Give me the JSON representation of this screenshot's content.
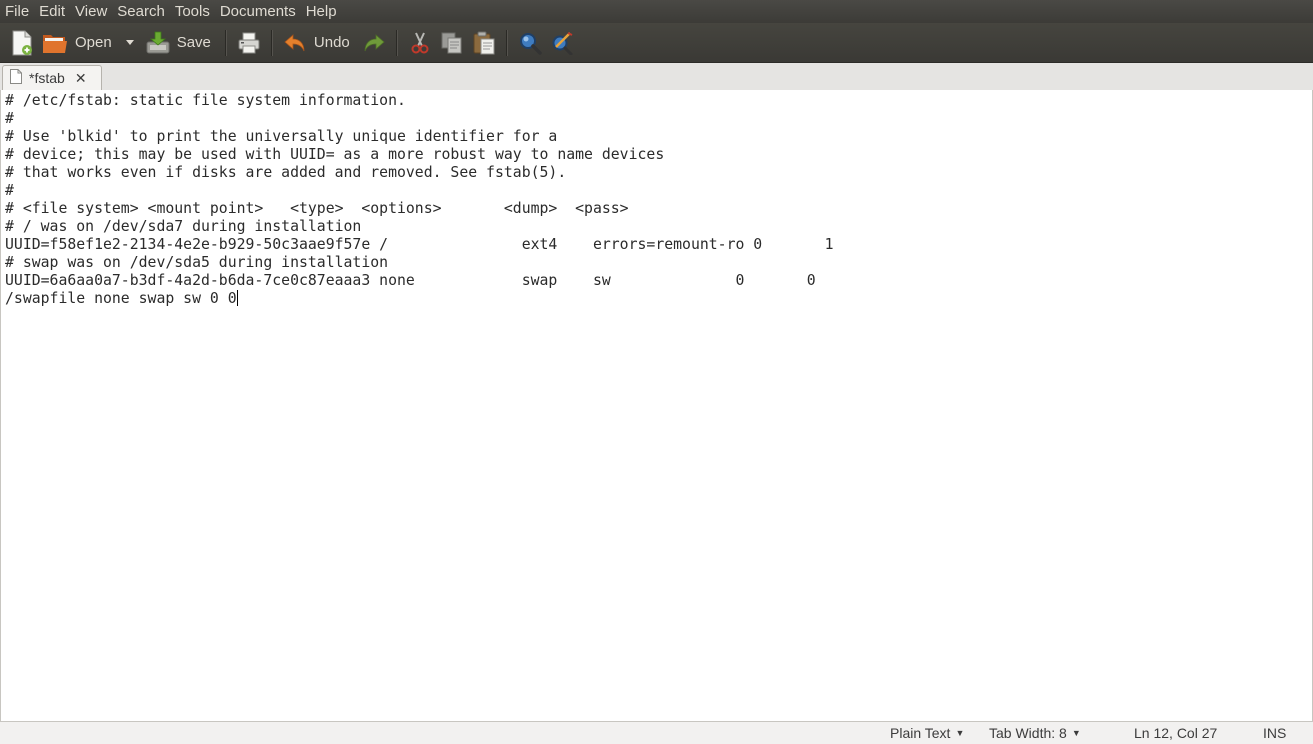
{
  "menubar": {
    "items": [
      "File",
      "Edit",
      "View",
      "Search",
      "Tools",
      "Documents",
      "Help"
    ]
  },
  "toolbar": {
    "new_icon": "new-document-icon",
    "open_label": "Open",
    "save_label": "Save",
    "print_icon": "print-icon",
    "undo_label": "Undo",
    "redo_icon": "redo-icon",
    "cut_icon": "cut-icon",
    "copy_icon": "copy-icon",
    "paste_icon": "paste-icon",
    "find_icon": "search-icon",
    "replace_icon": "find-replace-icon"
  },
  "tabs": [
    {
      "label": "*fstab",
      "close": "✕"
    }
  ],
  "editor": {
    "lines": [
      "# /etc/fstab: static file system information.",
      "#",
      "# Use 'blkid' to print the universally unique identifier for a",
      "# device; this may be used with UUID= as a more robust way to name devices",
      "# that works even if disks are added and removed. See fstab(5).",
      "#",
      "# <file system> <mount point>   <type>  <options>       <dump>  <pass>",
      "# / was on /dev/sda7 during installation",
      "UUID=f58ef1e2-2134-4e2e-b929-50c3aae9f57e /               ext4    errors=remount-ro 0       1",
      "# swap was on /dev/sda5 during installation",
      "UUID=6a6aa0a7-b3df-4a2d-b6da-7ce0c87eaaa3 none            swap    sw              0       0",
      "/swapfile none swap sw 0 0"
    ]
  },
  "statusbar": {
    "language": "Plain Text",
    "tab_width": "Tab Width: 8",
    "position": "Ln 12, Col 27",
    "mode": "INS"
  },
  "colors": {
    "menubar_bg": "#3c3b37",
    "toolbar_bg": "#3a3935",
    "menu_text": "#dfdbd2",
    "editor_bg": "#ffffff"
  }
}
